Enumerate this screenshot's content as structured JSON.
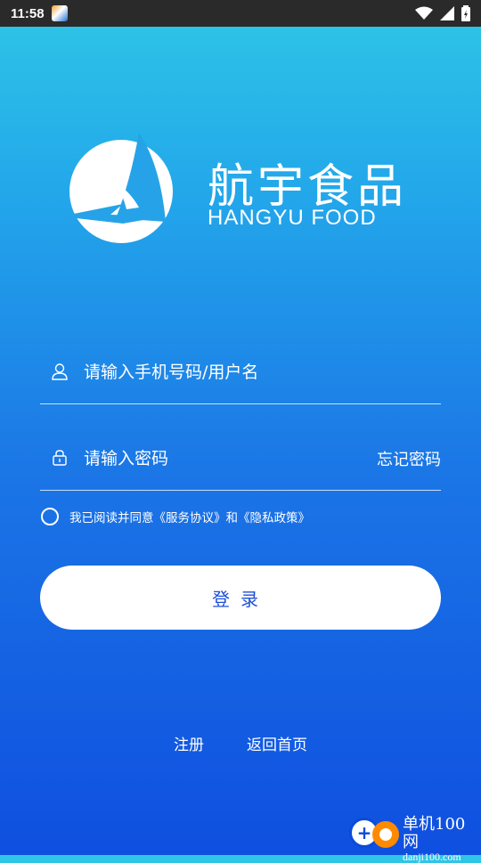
{
  "status_bar": {
    "time": "11:58"
  },
  "logo": {
    "cn": "航宇食品",
    "en": "HANGYU FOOD"
  },
  "form": {
    "username_placeholder": "请输入手机号码/用户名",
    "password_placeholder": "请输入密码",
    "forgot_password": "忘记密码",
    "agreement": "我已阅读并同意《服务协议》和《隐私政策》",
    "login_button": "登录"
  },
  "footer": {
    "register": "注册",
    "back_home": "返回首页"
  },
  "watermark": {
    "title": "单机100网",
    "url": "danji100.com"
  },
  "colors": {
    "accent": "#1e4fd6",
    "bg_top": "#2ec6e6",
    "bg_bottom": "#0f4fe0"
  }
}
